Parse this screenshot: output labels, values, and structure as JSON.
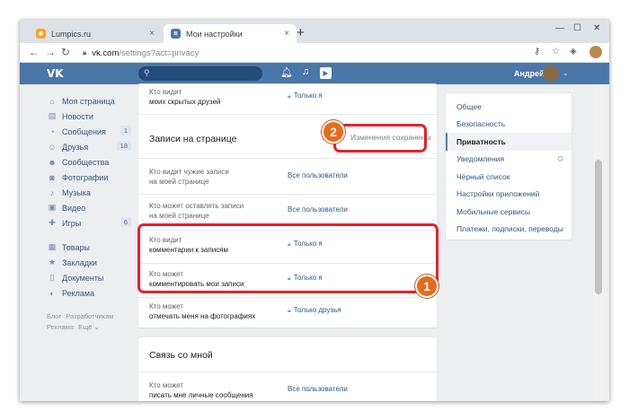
{
  "browser": {
    "tabs": [
      {
        "title": "Lumpics.ru",
        "close": "×"
      },
      {
        "title": "Мои настройки",
        "close": "×"
      }
    ],
    "new_tab": "+",
    "url_host": "vk.com",
    "url_path": "/settings?act=privacy"
  },
  "vk_header": {
    "logo": "VK",
    "username": "Андрей"
  },
  "left_nav": {
    "items": [
      {
        "label": "Моя страница",
        "icon": "home-icon",
        "count": ""
      },
      {
        "label": "Новости",
        "icon": "news-icon",
        "count": ""
      },
      {
        "label": "Сообщения",
        "icon": "messages-icon",
        "count": "1"
      },
      {
        "label": "Друзья",
        "icon": "friends-icon",
        "count": "18"
      },
      {
        "label": "Сообщества",
        "icon": "communities-icon",
        "count": ""
      },
      {
        "label": "Фотографии",
        "icon": "photos-icon",
        "count": ""
      },
      {
        "label": "Музыка",
        "icon": "music-icon",
        "count": ""
      },
      {
        "label": "Видео",
        "icon": "video-icon",
        "count": ""
      },
      {
        "label": "Игры",
        "icon": "games-icon",
        "count": "6"
      }
    ],
    "items2": [
      {
        "label": "Товары",
        "icon": "goods-icon"
      },
      {
        "label": "Закладки",
        "icon": "bookmarks-icon"
      },
      {
        "label": "Документы",
        "icon": "documents-icon"
      },
      {
        "label": "Реклама",
        "icon": "ads-icon"
      }
    ],
    "footer": [
      "Блог",
      "Разработчикам",
      "Реклама",
      "Ещё ⌄"
    ]
  },
  "top_card": {
    "q_line1": "Кто видит",
    "q_line2": "моих скрытых друзей",
    "value": "Только я"
  },
  "posts_section": {
    "title": "Записи на странице",
    "saved_status": "Изменения сохранены",
    "rows": [
      {
        "line1": "Кто видит чужие записи",
        "line2": "на моей странице",
        "value": "Все пользователи",
        "locked": false
      },
      {
        "line1": "Кто может оставлять записи",
        "line2": "на моей странице",
        "value": "Все пользователи",
        "locked": false
      },
      {
        "line1": "Кто видит",
        "line2": "комментарии к записям",
        "value": "Только я",
        "locked": true
      },
      {
        "line1": "Кто может",
        "line2": "комментировать мои записи",
        "value": "Только я",
        "locked": true
      },
      {
        "line1": "Кто может",
        "line2": "отмечать меня на фотографиях",
        "value": "Только друзья",
        "locked": true
      }
    ]
  },
  "contact_section": {
    "title": "Связь со мной",
    "row_line1": "Кто может",
    "row_line2": "писать мне личные сообщения",
    "row_value": "Все пользователи"
  },
  "right_menu": {
    "items": [
      "Общее",
      "Безопасность",
      "Приватность",
      "Уведомления",
      "Чёрный список",
      "Настройки приложений",
      "Мобильные сервисы",
      "Платежи, подписки, переводы"
    ],
    "active": "Приватность"
  },
  "annotations": {
    "badge1": "1",
    "badge2": "2",
    "highlight_color": "#e8202a",
    "badge_color": "#e86b1d"
  }
}
